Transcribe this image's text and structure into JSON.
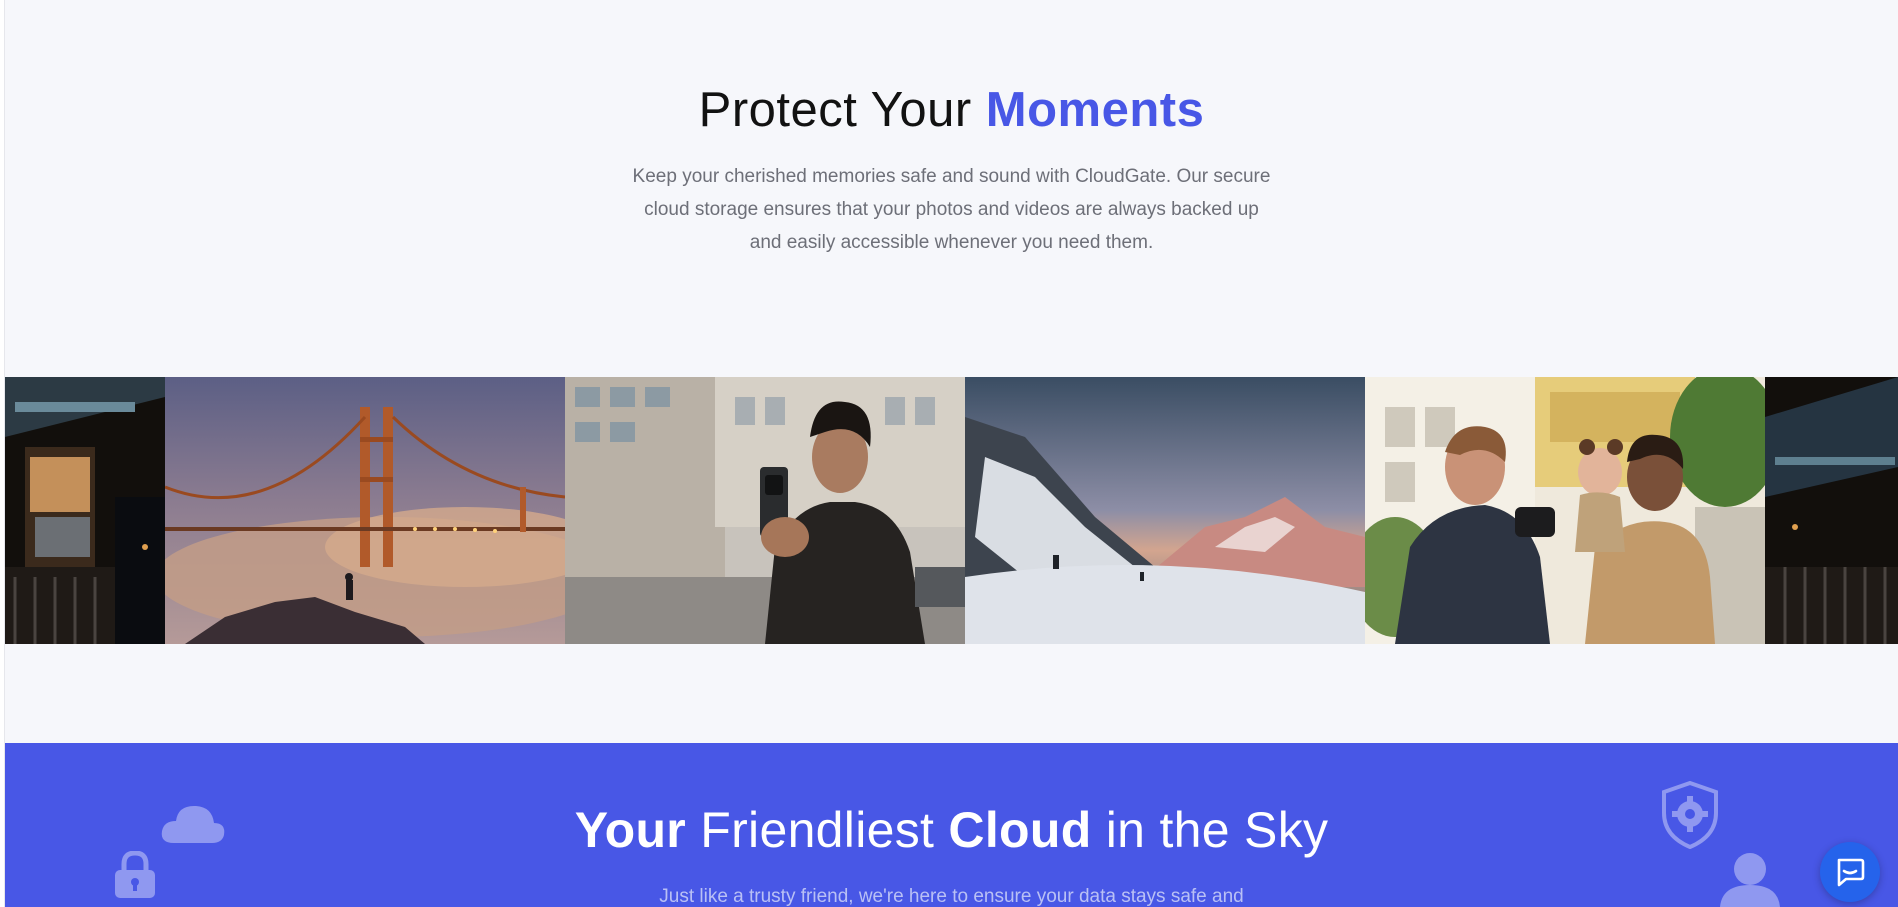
{
  "hero": {
    "title_plain": "Protect Your ",
    "title_accent": "Moments",
    "subtitle": "Keep your cherished memories safe and sound with CloudGate. Our secure cloud storage ensures that your photos and videos are always backed up and easily accessible whenever you need them."
  },
  "gallery": {
    "photos": [
      {
        "name": "night-building-balcony-photo"
      },
      {
        "name": "golden-gate-bridge-fog-photo"
      },
      {
        "name": "man-with-phone-street-photo"
      },
      {
        "name": "snowy-mountain-sunset-photo"
      },
      {
        "name": "family-with-baby-camera-photo"
      },
      {
        "name": "night-building-balcony-photo"
      }
    ]
  },
  "band": {
    "title_part1": "Your",
    "title_part2": " Friendliest ",
    "title_part3": "Cloud",
    "title_part4": " in the Sky",
    "subtitle": "Just like a trusty friend, we're here to ensure your data stays safe and"
  },
  "icons": {
    "cloud": "cloud-icon",
    "lock": "lock-icon",
    "shield": "shield-gear-icon",
    "user": "user-icon",
    "chat": "chat-bubble-icon"
  },
  "colors": {
    "accent": "#4857e6",
    "background": "#f6f7fb",
    "chat_button": "#2563eb"
  }
}
